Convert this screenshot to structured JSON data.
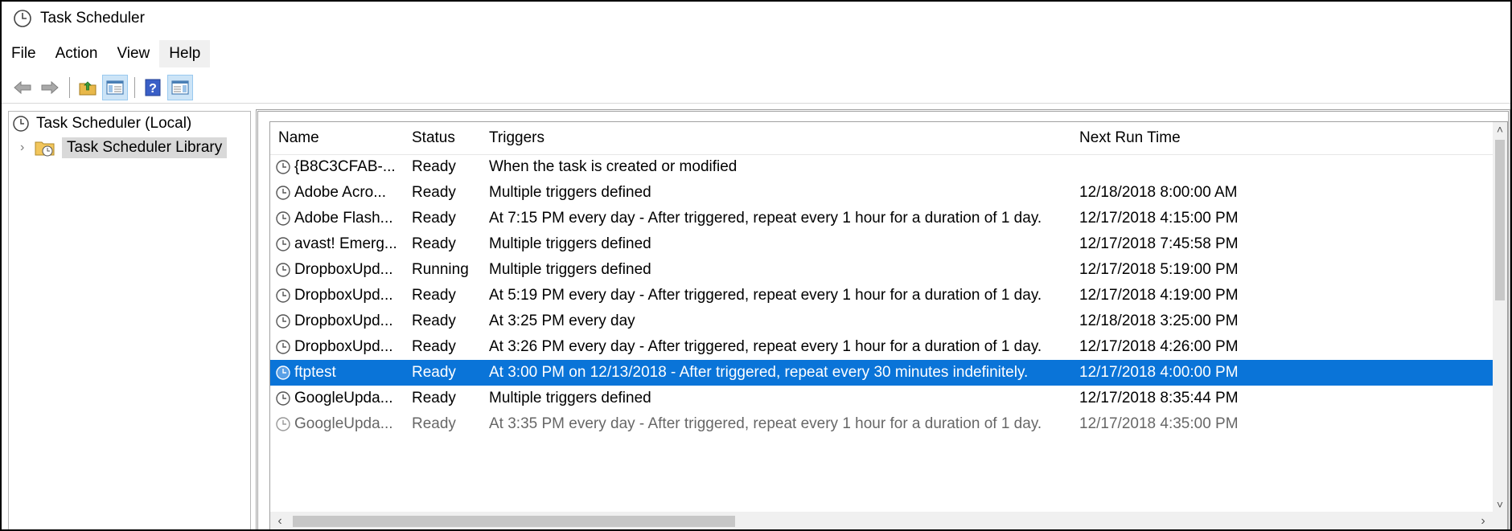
{
  "window": {
    "title": "Task Scheduler"
  },
  "menu": [
    "File",
    "Action",
    "View",
    "Help"
  ],
  "toolbar": {
    "buttons": [
      "back-arrow-icon",
      "forward-arrow-icon",
      "up-folder-icon",
      "show-hide-console-tree-icon",
      "help-icon",
      "show-hide-action-pane-icon"
    ]
  },
  "tree": {
    "root": "Task Scheduler (Local)",
    "library": "Task Scheduler Library"
  },
  "columns": {
    "name": "Name",
    "status": "Status",
    "triggers": "Triggers",
    "next_run": "Next Run Time"
  },
  "tasks": [
    {
      "name": "{B8C3CFAB-...",
      "status": "Ready",
      "triggers": "When the task is created or modified",
      "next_run": ""
    },
    {
      "name": "Adobe Acro...",
      "status": "Ready",
      "triggers": "Multiple triggers defined",
      "next_run": "12/18/2018 8:00:00 AM"
    },
    {
      "name": "Adobe Flash...",
      "status": "Ready",
      "triggers": "At 7:15 PM every day - After triggered, repeat every 1 hour for a duration of 1 day.",
      "next_run": "12/17/2018 4:15:00 PM"
    },
    {
      "name": "avast! Emerg...",
      "status": "Ready",
      "triggers": "Multiple triggers defined",
      "next_run": "12/17/2018 7:45:58 PM"
    },
    {
      "name": "DropboxUpd...",
      "status": "Running",
      "triggers": "Multiple triggers defined",
      "next_run": "12/17/2018 5:19:00 PM"
    },
    {
      "name": "DropboxUpd...",
      "status": "Ready",
      "triggers": "At 5:19 PM every day - After triggered, repeat every 1 hour for a duration of 1 day.",
      "next_run": "12/17/2018 4:19:00 PM"
    },
    {
      "name": "DropboxUpd...",
      "status": "Ready",
      "triggers": "At 3:25 PM every day",
      "next_run": "12/18/2018 3:25:00 PM"
    },
    {
      "name": "DropboxUpd...",
      "status": "Ready",
      "triggers": "At 3:26 PM every day - After triggered, repeat every 1 hour for a duration of 1 day.",
      "next_run": "12/17/2018 4:26:00 PM"
    },
    {
      "name": "ftptest",
      "status": "Ready",
      "triggers": "At 3:00 PM on 12/13/2018 - After triggered, repeat every 30 minutes indefinitely.",
      "next_run": "12/17/2018 4:00:00 PM",
      "selected": true
    },
    {
      "name": "GoogleUpda...",
      "status": "Ready",
      "triggers": "Multiple triggers defined",
      "next_run": "12/17/2018 8:35:44 PM"
    },
    {
      "name": "GoogleUpda...",
      "status": "Ready",
      "triggers": "At 3:35 PM every day - After triggered, repeat every 1 hour for a duration of 1 day.",
      "next_run": "12/17/2018 4:35:00 PM",
      "partial": true
    }
  ],
  "colors": {
    "selection": "#0a74d8",
    "tree_selection": "#d9d9d9"
  }
}
